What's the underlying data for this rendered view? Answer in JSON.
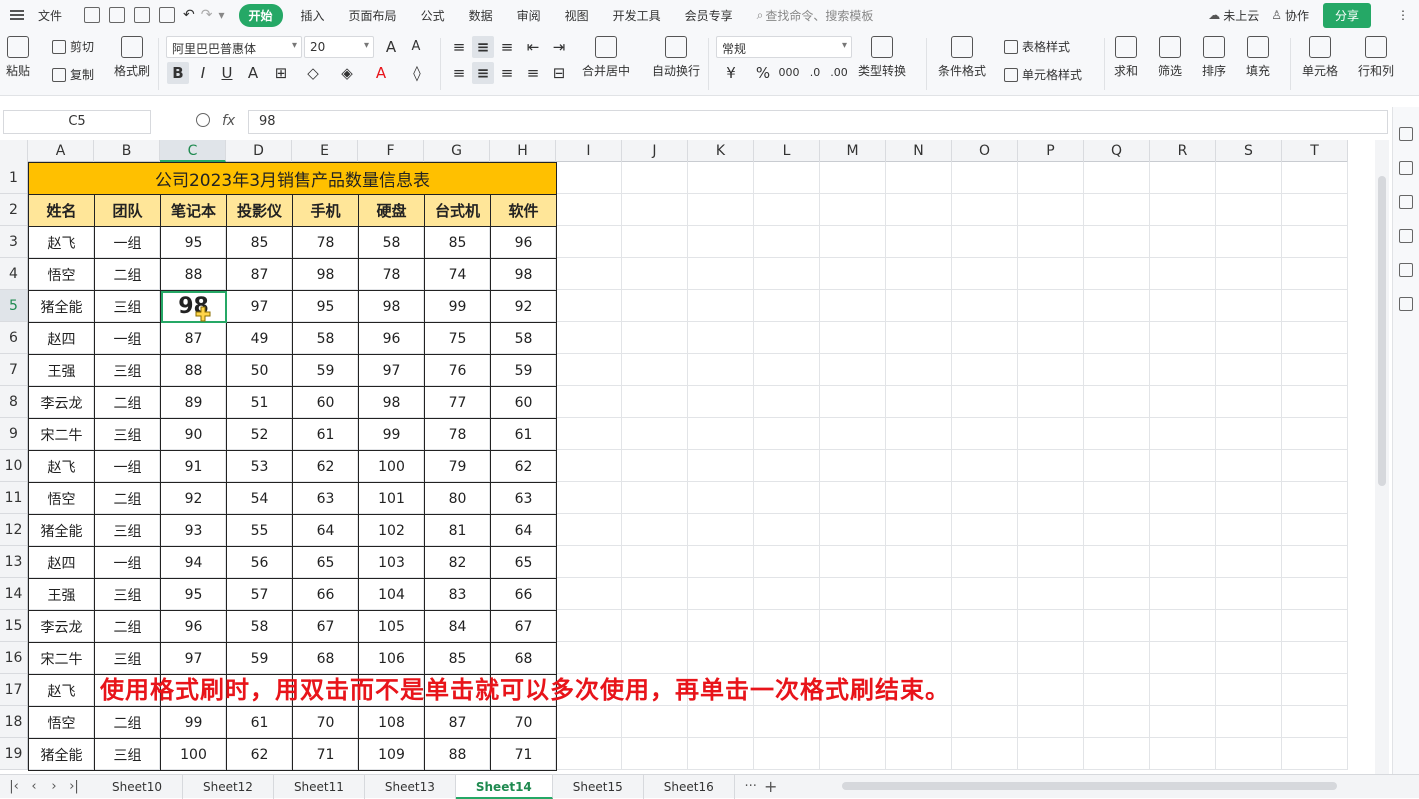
{
  "menubar": {
    "file": "文件",
    "tabs": [
      "开始",
      "插入",
      "页面布局",
      "公式",
      "数据",
      "审阅",
      "视图",
      "开发工具",
      "会员专享"
    ],
    "active_tab": "开始",
    "search_placeholder": "查找命令、搜索模板",
    "cloud": "未上云",
    "collab": "协作",
    "share": "分享"
  },
  "ribbon": {
    "paste": "粘贴",
    "cut": "剪切",
    "copy": "复制",
    "format_painter": "格式刷",
    "font_name": "阿里巴巴普惠体",
    "font_size": "20",
    "merge_center": "合并居中",
    "auto_wrap": "自动换行",
    "number_format": "常规",
    "type_convert": "类型转换",
    "conditional_format": "条件格式",
    "table_style": "表格样式",
    "cell_style": "单元格样式",
    "sum": "求和",
    "filter": "筛选",
    "sort": "排序",
    "fill": "填充",
    "cell": "单元格",
    "row_col": "行和列"
  },
  "formula_bar": {
    "name_box": "C5",
    "fx": "fx",
    "value": "98"
  },
  "columns": [
    "A",
    "B",
    "C",
    "D",
    "E",
    "F",
    "G",
    "H",
    "I",
    "J",
    "K",
    "L",
    "M",
    "N",
    "O",
    "P",
    "Q",
    "R",
    "S",
    "T"
  ],
  "selected_column": "C",
  "rows": [
    "1",
    "2",
    "3",
    "4",
    "5",
    "6",
    "7",
    "8",
    "9",
    "10",
    "11",
    "12",
    "13",
    "14",
    "15",
    "16",
    "17",
    "18",
    "19"
  ],
  "selected_row": "5",
  "table": {
    "title": "公司2023年3月销售产品数量信息表",
    "headers": [
      "姓名",
      "团队",
      "笔记本",
      "投影仪",
      "手机",
      "硬盘",
      "台式机",
      "软件"
    ],
    "rows": [
      [
        "赵飞",
        "一组",
        "95",
        "85",
        "78",
        "58",
        "85",
        "96"
      ],
      [
        "悟空",
        "二组",
        "88",
        "87",
        "98",
        "78",
        "74",
        "98"
      ],
      [
        "猪全能",
        "三组",
        "98",
        "97",
        "95",
        "98",
        "99",
        "92"
      ],
      [
        "赵四",
        "一组",
        "87",
        "49",
        "58",
        "96",
        "75",
        "58"
      ],
      [
        "王强",
        "三组",
        "88",
        "50",
        "59",
        "97",
        "76",
        "59"
      ],
      [
        "李云龙",
        "二组",
        "89",
        "51",
        "60",
        "98",
        "77",
        "60"
      ],
      [
        "宋二牛",
        "三组",
        "90",
        "52",
        "61",
        "99",
        "78",
        "61"
      ],
      [
        "赵飞",
        "一组",
        "91",
        "53",
        "62",
        "100",
        "79",
        "62"
      ],
      [
        "悟空",
        "二组",
        "92",
        "54",
        "63",
        "101",
        "80",
        "63"
      ],
      [
        "猪全能",
        "三组",
        "93",
        "55",
        "64",
        "102",
        "81",
        "64"
      ],
      [
        "赵四",
        "一组",
        "94",
        "56",
        "65",
        "103",
        "82",
        "65"
      ],
      [
        "王强",
        "三组",
        "95",
        "57",
        "66",
        "104",
        "83",
        "66"
      ],
      [
        "李云龙",
        "二组",
        "96",
        "58",
        "67",
        "105",
        "84",
        "67"
      ],
      [
        "宋二牛",
        "三组",
        "97",
        "59",
        "68",
        "106",
        "85",
        "68"
      ],
      [
        "赵飞",
        "",
        "",
        "",
        "",
        "",
        "",
        ""
      ],
      [
        "悟空",
        "二组",
        "99",
        "61",
        "70",
        "108",
        "87",
        "70"
      ],
      [
        "猪全能",
        "三组",
        "100",
        "62",
        "71",
        "109",
        "88",
        "71"
      ]
    ]
  },
  "overlay_caption": "使用格式刷时，用双击而不是单击就可以多次使用，再单击一次格式刷结束。",
  "sheets": [
    "Sheet10",
    "Sheet12",
    "Sheet11",
    "Sheet13",
    "Sheet14",
    "Sheet15",
    "Sheet16"
  ],
  "active_sheet": "Sheet14",
  "colors": {
    "accent": "#25a866",
    "title_fill": "#ffc000",
    "header_fill": "#ffe699",
    "caption": "#e8141a"
  }
}
